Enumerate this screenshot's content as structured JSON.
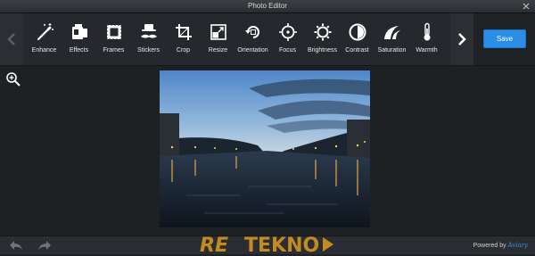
{
  "window": {
    "title": "Photo Editor"
  },
  "toolbar": {
    "tools": [
      {
        "label": "Enhance",
        "icon": "magic-wand-icon"
      },
      {
        "label": "Effects",
        "icon": "effects-icon"
      },
      {
        "label": "Frames",
        "icon": "frame-icon"
      },
      {
        "label": "Stickers",
        "icon": "mustache-hat-icon"
      },
      {
        "label": "Crop",
        "icon": "crop-icon"
      },
      {
        "label": "Resize",
        "icon": "resize-icon"
      },
      {
        "label": "Orientation",
        "icon": "rotate-icon"
      },
      {
        "label": "Focus",
        "icon": "focus-icon"
      },
      {
        "label": "Brightness",
        "icon": "sun-icon"
      },
      {
        "label": "Contrast",
        "icon": "contrast-icon"
      },
      {
        "label": "Saturation",
        "icon": "saturation-icon"
      },
      {
        "label": "Warmth",
        "icon": "thermometer-icon"
      }
    ],
    "save_label": "Save"
  },
  "footer": {
    "watermark_text": "RETEKNO",
    "powered_prefix": "Powered by",
    "powered_brand": "Aviary"
  },
  "colors": {
    "accent": "#2b8ee6",
    "background": "#1e2124",
    "watermark": "#c48a22"
  }
}
